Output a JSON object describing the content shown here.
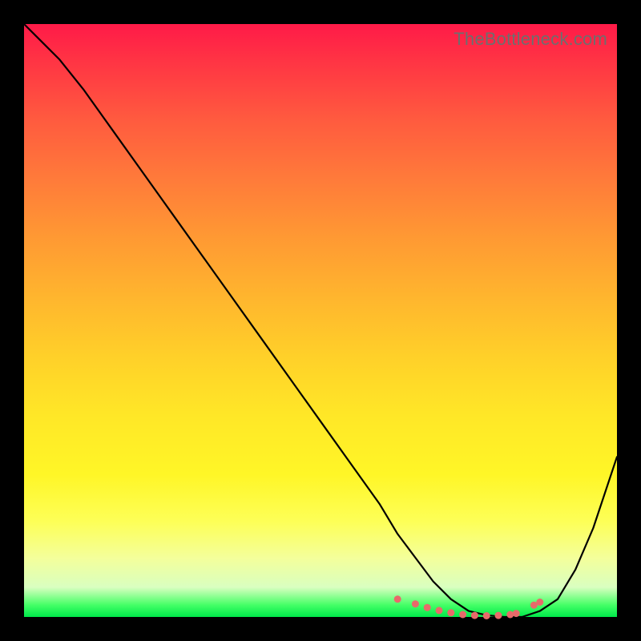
{
  "watermark": "TheBottleneck.com",
  "colors": {
    "background": "#000000",
    "gradient_top": "#ff1a48",
    "gradient_bottom": "#00e84a",
    "curve": "#000000",
    "dots": "#e86a6a"
  },
  "chart_data": {
    "type": "line",
    "title": "",
    "xlabel": "",
    "ylabel": "",
    "xlim": [
      0,
      100
    ],
    "ylim": [
      0,
      100
    ],
    "grid": false,
    "series": [
      {
        "name": "curve",
        "x": [
          0,
          3,
          6,
          10,
          15,
          20,
          25,
          30,
          35,
          40,
          45,
          50,
          55,
          60,
          63,
          66,
          69,
          72,
          75,
          78,
          81,
          84,
          87,
          90,
          93,
          96,
          100
        ],
        "values": [
          100,
          97,
          94,
          89,
          82,
          75,
          68,
          61,
          54,
          47,
          40,
          33,
          26,
          19,
          14,
          10,
          6,
          3,
          1,
          0.3,
          0,
          0,
          1,
          3,
          8,
          15,
          27
        ]
      }
    ],
    "annotations": {
      "marker_dots_x": [
        63,
        66,
        68,
        70,
        72,
        74,
        76,
        78,
        80,
        82,
        83,
        86,
        87
      ],
      "marker_dots_y": [
        3,
        2.2,
        1.6,
        1.1,
        0.7,
        0.4,
        0.25,
        0.2,
        0.25,
        0.4,
        0.6,
        2.0,
        2.5
      ]
    }
  }
}
